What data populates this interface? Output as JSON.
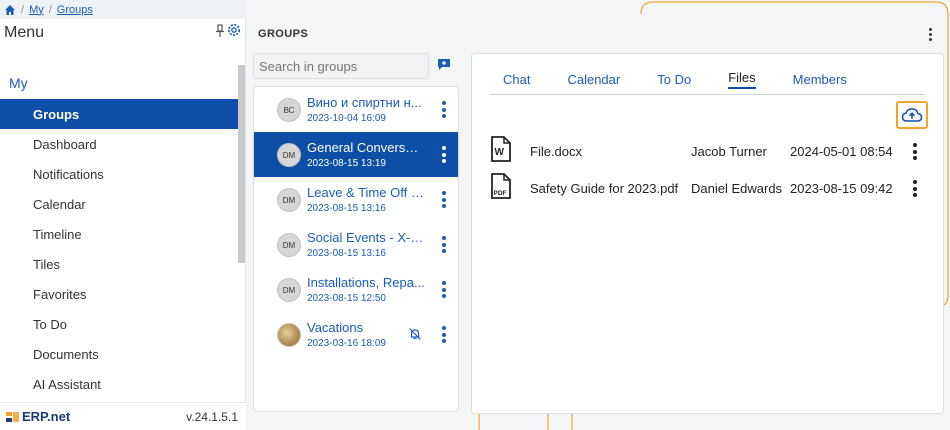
{
  "breadcrumb": {
    "items": [
      "My",
      "Groups"
    ]
  },
  "menu": {
    "title": "Menu",
    "section": "My",
    "items": [
      {
        "label": "Groups",
        "active": true
      },
      {
        "label": "Dashboard"
      },
      {
        "label": "Notifications"
      },
      {
        "label": "Calendar"
      },
      {
        "label": "Timeline"
      },
      {
        "label": "Tiles"
      },
      {
        "label": "Favorites"
      },
      {
        "label": "To Do"
      },
      {
        "label": "Documents"
      },
      {
        "label": "AI Assistant"
      }
    ]
  },
  "footer": {
    "logo": "ERP.net",
    "version": "v.24.1.5.1"
  },
  "groups": {
    "title": "GROUPS",
    "search_placeholder": "Search in groups",
    "items": [
      {
        "name": "Вино и спиртни н...",
        "date": "2023-10-04 16:09",
        "avatar": "ВС"
      },
      {
        "name": "General Conversat...",
        "date": "2023-08-15 13:19",
        "avatar": "DM",
        "active": true
      },
      {
        "name": "Leave & Time Off - ...",
        "date": "2023-08-15 13:16",
        "avatar": "DM"
      },
      {
        "name": "Social Events - X-T...",
        "date": "2023-08-15 13:16",
        "avatar": "DM"
      },
      {
        "name": "Installations, Repa...",
        "date": "2023-08-15 12:50",
        "avatar": "DM"
      },
      {
        "name": "Vacations",
        "date": "2023-03-16 18:09",
        "avatar": "",
        "muted": true
      }
    ]
  },
  "tabs": [
    "Chat",
    "Calendar",
    "To Do",
    "Files",
    "Members"
  ],
  "active_tab": "Files",
  "files": [
    {
      "name": "File.docx",
      "user": "Jacob Turner",
      "date": "2024-05-01 08:54",
      "icon": "word-doc-icon"
    },
    {
      "name": "Safety Guide for 2023.pdf",
      "user": "Daniel Edwards",
      "date": "2023-08-15 09:42",
      "icon": "pdf-icon"
    }
  ],
  "colors": {
    "accent": "#0d4ea6",
    "link": "#1a5eb5",
    "highlight": "#f2a32a"
  }
}
